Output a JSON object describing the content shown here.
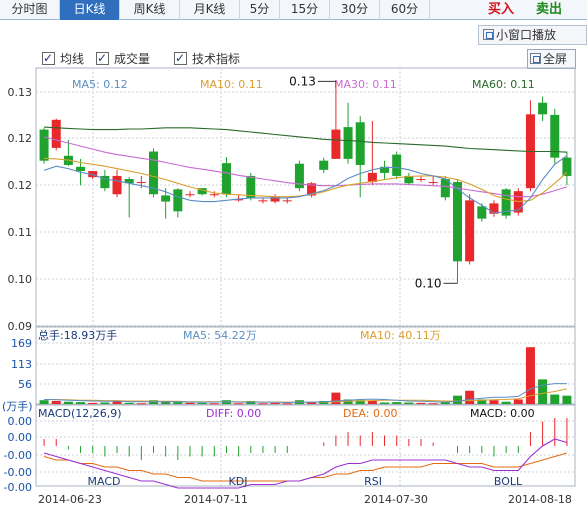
{
  "tabs": [
    {
      "label": "分时图",
      "active": false
    },
    {
      "label": "日K线",
      "active": true
    },
    {
      "label": "周K线",
      "active": false
    },
    {
      "label": "月K线",
      "active": false
    },
    {
      "label": "5分",
      "active": false
    },
    {
      "label": "15分",
      "active": false
    },
    {
      "label": "30分",
      "active": false
    },
    {
      "label": "60分",
      "active": false
    }
  ],
  "trade": {
    "buy_label": "买入",
    "sell_label": "卖出",
    "buy_color": "#d4141a",
    "sell_color": "#1d8a1d"
  },
  "toolbar": {
    "popout_label": "小窗口播放",
    "fullscreen_label": "全屏"
  },
  "checkboxes": [
    {
      "label": "均线",
      "checked": true
    },
    {
      "label": "成交量",
      "checked": true
    },
    {
      "label": "技术指标",
      "checked": true
    }
  ],
  "colors": {
    "up": "#e8282b",
    "down": "#1fa22e",
    "ma5": "#5b8dc4",
    "ma10": "#d9a02c",
    "ma30": "#c86cd2",
    "ma60": "#2b6b2b",
    "macd_dif": "#9d2fd3",
    "macd_dea": "#e46b12",
    "grid": "#ccd2d9",
    "axis": "#aab4c0"
  },
  "price_panel": {
    "legend": [
      {
        "key": "ma5",
        "text": "MA5: 0.12"
      },
      {
        "key": "ma10",
        "text": "MA10: 0.11"
      },
      {
        "key": "ma30",
        "text": "MA30: 0.11"
      },
      {
        "key": "ma60",
        "text": "MA60: 0.11"
      }
    ],
    "yticks": [
      "0.13",
      "0.12",
      "0.12",
      "0.11",
      "0.11",
      "0.10",
      "0.09"
    ],
    "high_label": "0.13",
    "low_label": "0.10"
  },
  "volume_panel": {
    "total_label": "总手:18.93万手",
    "ma5_label": "MA5: 54.22万",
    "ma10_label": "MA10: 40.11万",
    "yticks": [
      "169",
      "113",
      "56"
    ],
    "unit": "(万手)"
  },
  "macd_panel": {
    "title": "MACD(12,26,9)",
    "diff_label": "DIFF: 0.00",
    "dea_label": "DEA: 0.00",
    "macd_label": "MACD: 0.00",
    "yticks": [
      "0.00",
      "0.00",
      "-0.00",
      "-0.00",
      "-0.00"
    ]
  },
  "indicator_tabs": [
    "MACD",
    "KDJ",
    "RSI",
    "BOLL"
  ],
  "dates": [
    "2014-06-23",
    "2014-07-11",
    "2014-07-30",
    "2014-08-18"
  ],
  "chart_data": {
    "type": "candlestick",
    "ylim": [
      0.09,
      0.13
    ],
    "candles": [
      {
        "o": 0.1222,
        "c": 0.1171,
        "h": 0.1225,
        "l": 0.1166
      },
      {
        "o": 0.1192,
        "c": 0.1238,
        "h": 0.124,
        "l": 0.1188
      },
      {
        "o": 0.1179,
        "c": 0.1164,
        "h": 0.1205,
        "l": 0.1162
      },
      {
        "o": 0.1161,
        "c": 0.1154,
        "h": 0.1174,
        "l": 0.1131
      },
      {
        "o": 0.1144,
        "c": 0.1154,
        "h": 0.1154,
        "l": 0.1141
      },
      {
        "o": 0.1146,
        "c": 0.1126,
        "h": 0.1156,
        "l": 0.1121
      },
      {
        "o": 0.1116,
        "c": 0.1146,
        "h": 0.1156,
        "l": 0.1111
      },
      {
        "o": 0.1141,
        "c": 0.1134,
        "h": 0.1144,
        "l": 0.1078
      },
      {
        "o": 0.1136,
        "c": 0.1136,
        "h": 0.1146,
        "l": 0.1126
      },
      {
        "o": 0.1186,
        "c": 0.1116,
        "h": 0.1191,
        "l": 0.1111
      },
      {
        "o": 0.1114,
        "c": 0.1104,
        "h": 0.1126,
        "l": 0.1076
      },
      {
        "o": 0.1124,
        "c": 0.1088,
        "h": 0.1126,
        "l": 0.1078
      },
      {
        "o": 0.1116,
        "c": 0.1116,
        "h": 0.1121,
        "l": 0.1111
      },
      {
        "o": 0.1126,
        "c": 0.1116,
        "h": 0.1126,
        "l": 0.1114
      },
      {
        "o": 0.1116,
        "c": 0.1116,
        "h": 0.1121,
        "l": 0.1111
      },
      {
        "o": 0.1167,
        "c": 0.1116,
        "h": 0.1177,
        "l": 0.1111
      },
      {
        "o": 0.1106,
        "c": 0.1108,
        "h": 0.1116,
        "l": 0.1104
      },
      {
        "o": 0.1146,
        "c": 0.1109,
        "h": 0.1151,
        "l": 0.1106
      },
      {
        "o": 0.1106,
        "c": 0.1106,
        "h": 0.1111,
        "l": 0.1101
      },
      {
        "o": 0.1104,
        "c": 0.1112,
        "h": 0.1116,
        "l": 0.1101
      },
      {
        "o": 0.1106,
        "c": 0.1106,
        "h": 0.1111,
        "l": 0.1101
      },
      {
        "o": 0.1166,
        "c": 0.1126,
        "h": 0.1171,
        "l": 0.1121
      },
      {
        "o": 0.1114,
        "c": 0.1134,
        "h": 0.1136,
        "l": 0.1111
      },
      {
        "o": 0.1171,
        "c": 0.1156,
        "h": 0.1176,
        "l": 0.1151
      },
      {
        "o": 0.1174,
        "c": 0.1222,
        "h": 0.1301,
        "l": 0.1174
      },
      {
        "o": 0.1226,
        "c": 0.1174,
        "h": 0.1266,
        "l": 0.1166
      },
      {
        "o": 0.1234,
        "c": 0.1164,
        "h": 0.1244,
        "l": 0.1111
      },
      {
        "o": 0.1136,
        "c": 0.1151,
        "h": 0.1236,
        "l": 0.1131
      },
      {
        "o": 0.1161,
        "c": 0.1151,
        "h": 0.1171,
        "l": 0.1141
      },
      {
        "o": 0.1181,
        "c": 0.1146,
        "h": 0.1186,
        "l": 0.1141
      },
      {
        "o": 0.1146,
        "c": 0.1134,
        "h": 0.1151,
        "l": 0.1131
      },
      {
        "o": 0.1141,
        "c": 0.1141,
        "h": 0.1146,
        "l": 0.1136
      },
      {
        "o": 0.1136,
        "c": 0.1136,
        "h": 0.1146,
        "l": 0.1131
      },
      {
        "o": 0.1141,
        "c": 0.1111,
        "h": 0.1146,
        "l": 0.1106
      },
      {
        "o": 0.1136,
        "c": 0.1006,
        "h": 0.1141,
        "l": 0.097
      },
      {
        "o": 0.1006,
        "c": 0.1106,
        "h": 0.1116,
        "l": 0.1001
      },
      {
        "o": 0.1096,
        "c": 0.1076,
        "h": 0.1101,
        "l": 0.1071
      },
      {
        "o": 0.1084,
        "c": 0.1101,
        "h": 0.1106,
        "l": 0.1079
      },
      {
        "o": 0.1124,
        "c": 0.1081,
        "h": 0.1126,
        "l": 0.1076
      },
      {
        "o": 0.1086,
        "c": 0.1121,
        "h": 0.1126,
        "l": 0.1081
      },
      {
        "o": 0.1126,
        "c": 0.1247,
        "h": 0.127,
        "l": 0.1121
      },
      {
        "o": 0.1266,
        "c": 0.1247,
        "h": 0.1276,
        "l": 0.1236
      },
      {
        "o": 0.1246,
        "c": 0.1176,
        "h": 0.1256,
        "l": 0.1166
      },
      {
        "o": 0.1176,
        "c": 0.1146,
        "h": 0.1186,
        "l": 0.1131
      }
    ],
    "ma5": [
      0.1155,
      0.1162,
      0.1158,
      0.1152,
      0.1148,
      0.1141,
      0.1138,
      0.1134,
      0.113,
      0.1126,
      0.112,
      0.1112,
      0.1106,
      0.1104,
      0.1104,
      0.1106,
      0.1108,
      0.111,
      0.111,
      0.111,
      0.111,
      0.1112,
      0.1117,
      0.1122,
      0.113,
      0.1142,
      0.115,
      0.1156,
      0.116,
      0.116,
      0.1156,
      0.115,
      0.1146,
      0.1141,
      0.1125,
      0.111,
      0.1098,
      0.1085,
      0.1088,
      0.109,
      0.111,
      0.114,
      0.1165,
      0.1179
    ],
    "ma10": [
      0.1175,
      0.1174,
      0.1172,
      0.1168,
      0.1165,
      0.1162,
      0.1158,
      0.1154,
      0.115,
      0.1145,
      0.114,
      0.1134,
      0.1128,
      0.1123,
      0.1118,
      0.1116,
      0.1115,
      0.1114,
      0.1113,
      0.1112,
      0.1112,
      0.1113,
      0.1116,
      0.112,
      0.1126,
      0.1131,
      0.1134,
      0.1137,
      0.114,
      0.1143,
      0.1145,
      0.1146,
      0.1146,
      0.1144,
      0.114,
      0.1133,
      0.1124,
      0.1114,
      0.1108,
      0.1104,
      0.1106,
      0.1118,
      0.1134,
      0.1152
    ],
    "ma30": [
      0.121,
      0.1205,
      0.12,
      0.1195,
      0.119,
      0.1185,
      0.1181,
      0.1178,
      0.1175,
      0.1172,
      0.1168,
      0.1164,
      0.116,
      0.1157,
      0.1154,
      0.1151,
      0.1147,
      0.1144,
      0.1141,
      0.1138,
      0.1135,
      0.1133,
      0.1131,
      0.113,
      0.113,
      0.1131,
      0.1132,
      0.1133,
      0.1133,
      0.1133,
      0.1132,
      0.1131,
      0.113,
      0.1129,
      0.1126,
      0.1123,
      0.112,
      0.1117,
      0.1114,
      0.1112,
      0.1112,
      0.1116,
      0.1122,
      0.1128
    ],
    "ma60": [
      0.1226,
      0.1225,
      0.1224,
      0.1223,
      0.1222,
      0.1222,
      0.1222,
      0.1223,
      0.1223,
      0.1224,
      0.1225,
      0.1225,
      0.1225,
      0.1224,
      0.1223,
      0.1222,
      0.122,
      0.1218,
      0.1216,
      0.1214,
      0.1212,
      0.121,
      0.1208,
      0.1206,
      0.1205,
      0.1204,
      0.1203,
      0.1201,
      0.12,
      0.1199,
      0.1198,
      0.1197,
      0.1196,
      0.1195,
      0.1193,
      0.1191,
      0.119,
      0.1189,
      0.1188,
      0.1187,
      0.1186,
      0.1186,
      0.1186,
      0.1185
    ],
    "volume": [
      10,
      8,
      6,
      5,
      3,
      4,
      8,
      3,
      2,
      10,
      6,
      5,
      3,
      3,
      2,
      10,
      2,
      8,
      2,
      3,
      2,
      10,
      4,
      8,
      30,
      12,
      10,
      8,
      4,
      5,
      4,
      3,
      2,
      4,
      22,
      35,
      12,
      10,
      6,
      12,
      150,
      65,
      25,
      22
    ],
    "volume_ma5": [
      12,
      11,
      10,
      9,
      8,
      7,
      7,
      6,
      6,
      6,
      6,
      6,
      5,
      5,
      5,
      6,
      5,
      5,
      5,
      5,
      4,
      5,
      5,
      6,
      8,
      10,
      12,
      13,
      12,
      10,
      8,
      7,
      6,
      5,
      7,
      12,
      15,
      18,
      18,
      20,
      40,
      50,
      54,
      54
    ],
    "volume_ma10": [
      12,
      12,
      11,
      10,
      10,
      9,
      9,
      8,
      8,
      7,
      7,
      7,
      6,
      6,
      6,
      6,
      6,
      6,
      5,
      5,
      5,
      5,
      5,
      5,
      6,
      7,
      8,
      9,
      10,
      10,
      10,
      10,
      9,
      8,
      8,
      9,
      10,
      11,
      12,
      14,
      22,
      28,
      33,
      40
    ],
    "macd_hist": [
      0.0002,
      0.0002,
      -0.0001,
      -0.0002,
      -0.0002,
      -0.0003,
      -0.0002,
      -0.0003,
      -0.0004,
      -0.0002,
      -0.0003,
      -0.0004,
      -0.0003,
      -0.0003,
      -0.0003,
      -0.0002,
      -0.0003,
      -0.0002,
      -0.0002,
      -0.0002,
      -0.0002,
      0.0,
      0.0,
      0.0001,
      0.0003,
      0.0004,
      0.0003,
      0.0004,
      0.0003,
      0.0003,
      0.0002,
      0.0002,
      0.0001,
      0.0,
      -0.0002,
      -0.0002,
      -0.0002,
      -0.0003,
      -0.0002,
      -0.0002,
      0.0004,
      0.0007,
      0.0008,
      0.0008
    ],
    "macd_dif": [
      -0.0002,
      -0.0003,
      -0.0004,
      -0.0005,
      -0.0006,
      -0.0007,
      -0.0008,
      -0.0009,
      -0.001,
      -0.001,
      -0.0011,
      -0.0012,
      -0.0012,
      -0.0012,
      -0.0012,
      -0.0012,
      -0.0012,
      -0.0011,
      -0.0011,
      -0.0011,
      -0.001,
      -0.001,
      -0.0009,
      -0.0008,
      -0.0006,
      -0.0005,
      -0.0005,
      -0.0004,
      -0.0004,
      -0.0004,
      -0.0004,
      -0.0004,
      -0.0004,
      -0.0004,
      -0.0005,
      -0.0006,
      -0.0006,
      -0.0007,
      -0.0007,
      -0.0007,
      -0.0003,
      0.0,
      0.0002,
      0.0001
    ],
    "macd_dea": [
      -0.0003,
      -0.0004,
      -0.0004,
      -0.0005,
      -0.0005,
      -0.0006,
      -0.0006,
      -0.0007,
      -0.0007,
      -0.0008,
      -0.0008,
      -0.0009,
      -0.0009,
      -0.001,
      -0.001,
      -0.001,
      -0.001,
      -0.001,
      -0.001,
      -0.001,
      -0.001,
      -0.001,
      -0.0009,
      -0.0009,
      -0.0008,
      -0.0008,
      -0.0007,
      -0.0007,
      -0.0006,
      -0.0006,
      -0.0006,
      -0.0006,
      -0.0005,
      -0.0005,
      -0.0005,
      -0.0005,
      -0.0005,
      -0.0006,
      -0.0006,
      -0.0006,
      -0.0005,
      -0.0004,
      -0.0003,
      -0.0002
    ]
  }
}
